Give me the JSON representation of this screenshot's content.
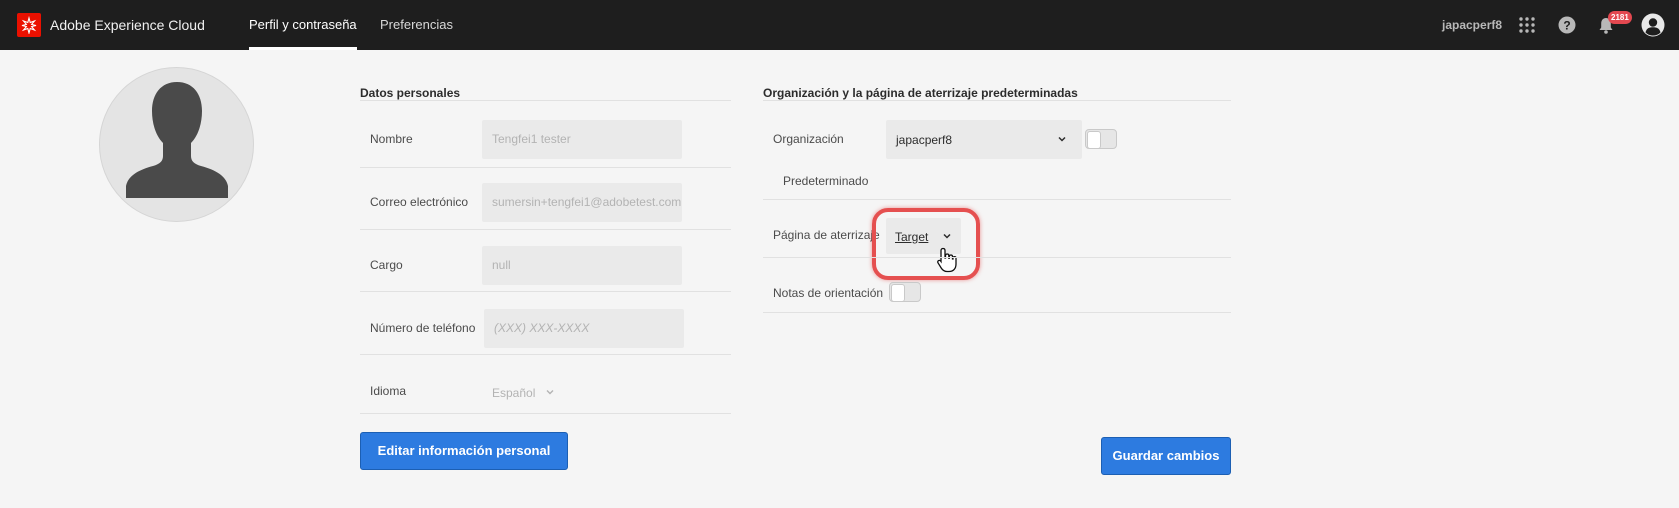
{
  "header": {
    "app_title": "Adobe Experience Cloud",
    "tabs": [
      {
        "label": "Perfil y contraseña",
        "active": true
      },
      {
        "label": "Preferencias",
        "active": false
      }
    ],
    "org_name": "japacperf8",
    "notification_count": "2181",
    "icons": [
      "apps-grid-icon",
      "help-icon",
      "bell-icon",
      "user-avatar-icon"
    ]
  },
  "personal": {
    "title": "Datos personales",
    "fields": [
      {
        "label": "Nombre",
        "value": "Tengfei1 tester"
      },
      {
        "label": "Correo electrónico",
        "value": "sumersin+tengfei1@adobetest.com"
      },
      {
        "label": "Cargo",
        "value": "null"
      },
      {
        "label": "Número de teléfono",
        "placeholder": "(XXX) XXX-XXXX"
      },
      {
        "label": "Idioma",
        "value": "Español"
      }
    ],
    "edit_button": "Editar información personal"
  },
  "org": {
    "title": "Organización y la página de aterrizaje predeterminadas",
    "org_label": "Organización",
    "org_value": "japacperf8",
    "default_label": "Predeterminado",
    "landing_label": "Página de aterrizaje",
    "landing_value": "Target",
    "notes_label": "Notas de orientación",
    "save_button": "Guardar cambios"
  },
  "colors": {
    "header_bg": "#1e1e1e",
    "adobe_red": "#eb1000",
    "primary_blue": "#2d7be0",
    "badge_red": "#e34850",
    "highlight": "#e55050"
  }
}
